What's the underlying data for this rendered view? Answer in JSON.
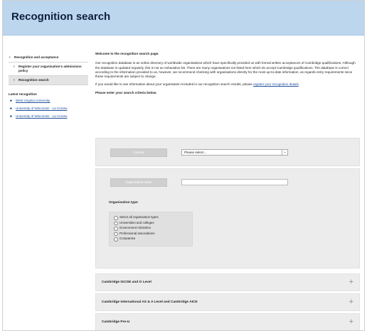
{
  "header": {
    "title": "Recognition search"
  },
  "sidebar": {
    "items": [
      {
        "label": "Recognition and acceptance"
      },
      {
        "label": "Register your organisation's admissions policy"
      },
      {
        "label": "Recognition search"
      }
    ],
    "latest_heading": "Latest recognition",
    "latest": [
      {
        "label": "West Virginia University"
      },
      {
        "label": "University of Wisconsin - La Crosse"
      },
      {
        "label": "University of Wisconsin - La Crosse"
      }
    ]
  },
  "main": {
    "welcome": "Welcome to the recognition search page.",
    "intro": "Our recognition database is an online directory of worldwide organisations which have specifically provided us with formal written acceptances of Cambridge qualifications. Although the database is updated regularly, this is not an exhaustive list. There are many organisations not listed here which do accept Cambridge qualifications. The database is correct according to the information provided to us, however, we recommend checking with organisations directly for the most up-to-date information, as regards entry requirements since these requirements are subject to change.",
    "register_prompt": "If you would like to see information about your organisation included in our recognition search results, please",
    "register_link": "register your recognition details",
    "register_end": ".",
    "criteria_prompt": "Please enter your search criteria below."
  },
  "search": {
    "country_label": "Country",
    "country_value": "Please select...",
    "org_name_label": "Organisation name",
    "org_name_value": "",
    "org_type_label": "Organisation type",
    "org_types": [
      "Select all organisation types",
      "Universities and colleges",
      "Government ministries",
      "Professional associations",
      "Companies"
    ]
  },
  "accordions": [
    {
      "label": "Cambridge IGCSE and O Level"
    },
    {
      "label": "Cambridge International AS & A Level and Cambridge AICE"
    },
    {
      "label": "Cambridge Pre-U"
    }
  ],
  "icons": {
    "arrow": "›",
    "chevron": "⌄",
    "plus": "+",
    "bullet": "■"
  }
}
